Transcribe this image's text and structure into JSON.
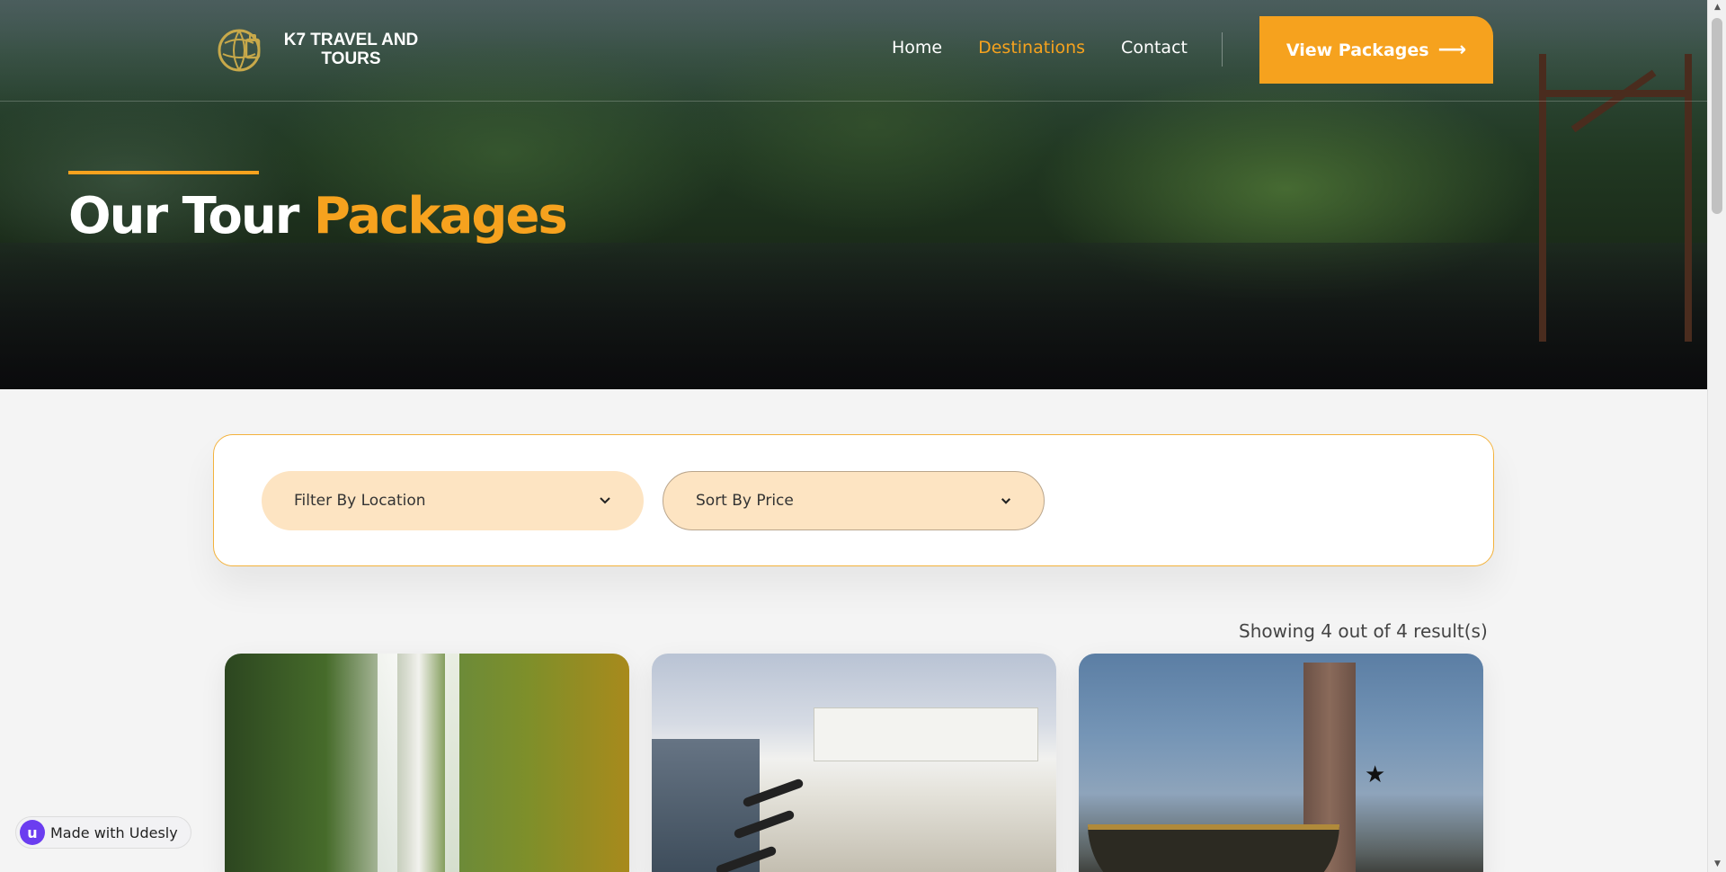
{
  "brand": {
    "name": "K7 TRAVEL AND TOURS",
    "accent_color": "#f6a21e"
  },
  "nav": {
    "links": [
      {
        "label": "Home",
        "active": false
      },
      {
        "label": "Destinations",
        "active": true
      },
      {
        "label": "Contact",
        "active": false
      }
    ],
    "cta_label": "View Packages",
    "cta_icon": "arrow-right-icon"
  },
  "hero": {
    "title_part1": "Our Tour ",
    "title_highlight": "Packages"
  },
  "filters": {
    "location": {
      "selected": "Filter By Location",
      "icon": "chevron-down-icon"
    },
    "price": {
      "selected": "Sort By Price",
      "icon": "chevron-down-icon"
    }
  },
  "results": {
    "text": "Showing 4 out of 4 result(s)"
  },
  "cards": [
    {
      "image": "waterfall-photo"
    },
    {
      "image": "coastal-castle-photo"
    },
    {
      "image": "monument-photo"
    }
  ],
  "badge": {
    "icon_letter": "u",
    "label": "Made with Udesly"
  }
}
